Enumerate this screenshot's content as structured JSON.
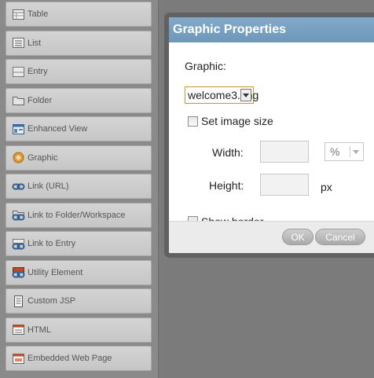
{
  "sidebar": {
    "items": [
      {
        "label": "Table",
        "icon": "table-icon"
      },
      {
        "label": "List",
        "icon": "list-icon"
      },
      {
        "label": "Entry",
        "icon": "entry-icon"
      },
      {
        "label": "Folder",
        "icon": "folder-icon"
      },
      {
        "label": "Enhanced View",
        "icon": "enhanced-view-icon"
      },
      {
        "label": "Graphic",
        "icon": "graphic-icon"
      },
      {
        "label": "Link (URL)",
        "icon": "link-icon"
      },
      {
        "label": "Link to Folder/Workspace",
        "icon": "link-folder-icon"
      },
      {
        "label": "Link to Entry",
        "icon": "link-entry-icon"
      },
      {
        "label": "Utility Element",
        "icon": "utility-icon"
      },
      {
        "label": "Custom JSP",
        "icon": "document-icon"
      },
      {
        "label": "HTML",
        "icon": "html-icon"
      },
      {
        "label": "Embedded Web Page",
        "icon": "web-page-icon"
      }
    ]
  },
  "dialog": {
    "title": "Graphic Properties",
    "graphic_label": "Graphic:",
    "graphic_value": "welcome3.png",
    "set_size_label": "Set image size",
    "width_label": "Width:",
    "width_unit": "%",
    "height_label": "Height:",
    "height_unit": "px",
    "show_border_label": "Show border",
    "ok_label": "OK",
    "cancel_label": "Cancel"
  }
}
